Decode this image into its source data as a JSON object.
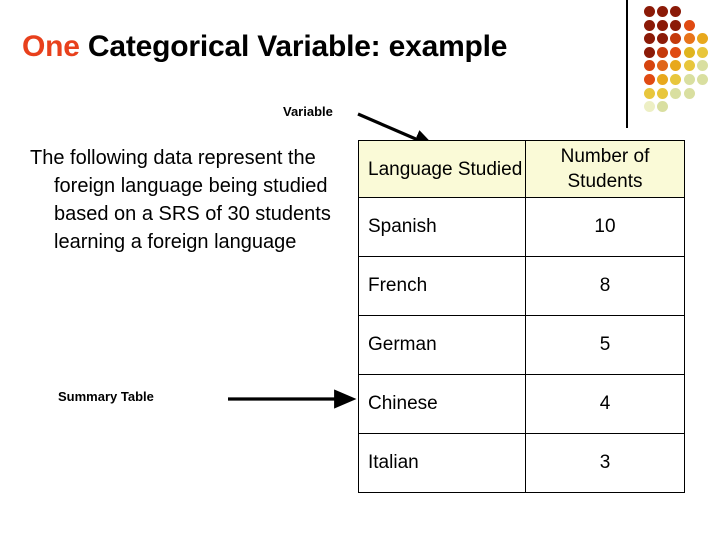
{
  "slide": {
    "title": {
      "accent_word": "One",
      "rest": " Categorical Variable: example"
    },
    "body_text": "The following data represent the foreign language being studied based on a SRS of 30 students learning a foreign language",
    "callouts": {
      "variable_label": "Variable",
      "summary_label": "Summary Table"
    },
    "table": {
      "headers": {
        "language": "Language Studied",
        "count": "Number of Students"
      },
      "rows": [
        {
          "language": "Spanish",
          "count": "10"
        },
        {
          "language": "French",
          "count": "8"
        },
        {
          "language": "German",
          "count": "5"
        },
        {
          "language": "Chinese",
          "count": "4"
        },
        {
          "language": "Italian",
          "count": "3"
        }
      ]
    },
    "colors": {
      "title_accent": "#E8401C",
      "title_text": "#000000",
      "header_fill": "#FAFAD7",
      "border": "#000000",
      "background": "#FFFFFF"
    },
    "decoration": {
      "name": "dot-grid",
      "rows": [
        {
          "dots": [
            "#8B1A07",
            "#8B1A07",
            "#8B1A07"
          ]
        },
        {
          "dots": [
            "#8B1A07",
            "#8B1A07",
            "#8B1A07",
            "#E04A12"
          ]
        },
        {
          "dots": [
            "#8B1A07",
            "#8B1A07",
            "#C43A0C",
            "#E8731A",
            "#E8A81C"
          ]
        },
        {
          "dots": [
            "#8B1A07",
            "#C43A0C",
            "#E04A12",
            "#E0B41E",
            "#E8C63C"
          ]
        },
        {
          "dots": [
            "#D6440E",
            "#E0651A",
            "#E8A81C",
            "#E8C63C",
            "#D9DFA0"
          ]
        },
        {
          "dots": [
            "#E04A12",
            "#E8A81C",
            "#E8C63C",
            "#D9DFA0",
            "#D9DFA0"
          ]
        },
        {
          "dots": [
            "#E8C63C",
            "#E8C63C",
            "#D9DFA0",
            "#D9DFA0"
          ]
        },
        {
          "dots": [
            "#EDEFC4",
            "#D9DFA0"
          ]
        }
      ]
    }
  }
}
